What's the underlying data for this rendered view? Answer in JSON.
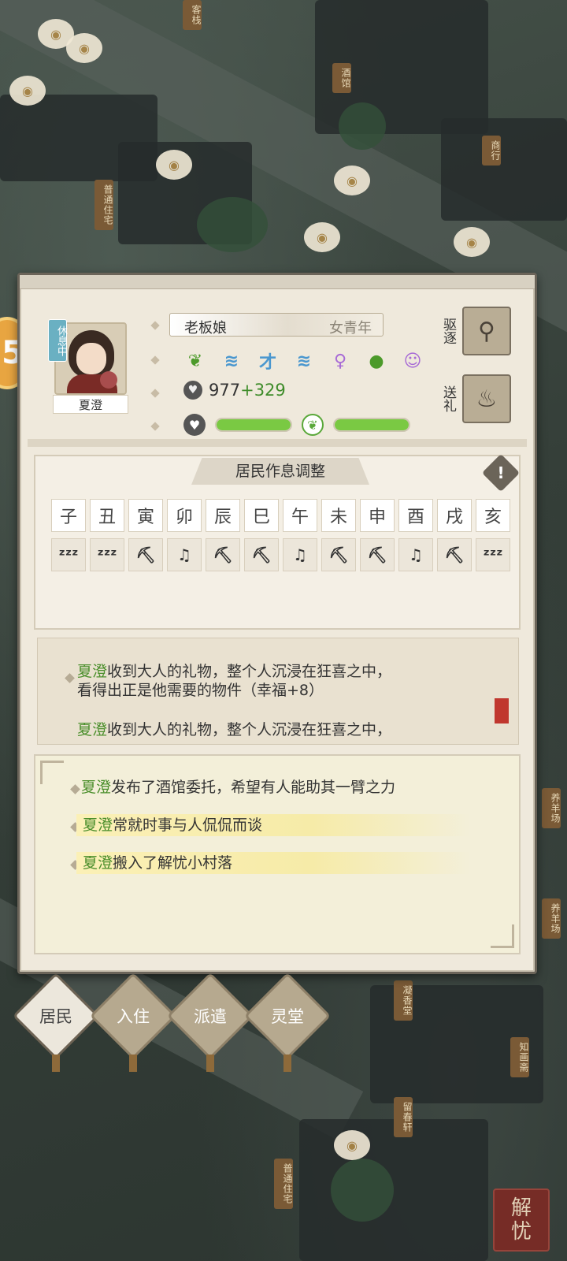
{
  "background": {
    "signs": [
      "客栈",
      "酒馆",
      "普通住宅",
      "商行",
      "养羊场",
      "养羊场",
      "凝香堂",
      "知画斋",
      "留春轩",
      "普通住宅"
    ]
  },
  "resident": {
    "status": "休息中",
    "name": "夏澄",
    "role": "老板娘",
    "age_group": "女青年",
    "traits": [
      {
        "icon": "heart-leaf-icon",
        "glyph": "❦",
        "color": "green"
      },
      {
        "icon": "fish-icon",
        "glyph": "≋",
        "color": "blue"
      },
      {
        "icon": "talent-icon",
        "glyph": "才",
        "color": "blue"
      },
      {
        "icon": "fish-icon",
        "glyph": "≋",
        "color": "blue"
      },
      {
        "icon": "person-purple-icon",
        "glyph": "♀",
        "color": "purple"
      },
      {
        "icon": "person-green-icon",
        "glyph": "●",
        "color": "green"
      },
      {
        "icon": "person-purple-icon",
        "glyph": "☺",
        "color": "purple"
      }
    ],
    "wealth": "977",
    "wealth_bonus": "+329",
    "health_level": 1.0,
    "happiness_level": 1.0
  },
  "actions": {
    "expel": "驱逐",
    "gift": "送礼"
  },
  "schedule": {
    "title": "居民作息调整",
    "hours": [
      "子",
      "丑",
      "寅",
      "卯",
      "辰",
      "巳",
      "午",
      "未",
      "申",
      "酉",
      "戌",
      "亥"
    ],
    "activities": [
      "sleep",
      "sleep",
      "work",
      "leisure",
      "work",
      "work",
      "leisure",
      "work",
      "work",
      "leisure",
      "work",
      "sleep"
    ],
    "activity_glyphs": {
      "sleep": "ᶻᶻᶻ",
      "work": "⛏",
      "leisure": "♫"
    }
  },
  "log1": {
    "name": "夏澄",
    "line1": "收到大人的礼物，整个人沉浸在狂喜之中，",
    "line2": "看得出正是他需要的物件（幸福+8）",
    "name_b": "夏澄",
    "line3": "收到大人的礼物，整个人沉浸在狂喜之中，"
  },
  "log2": [
    {
      "name": "夏澄",
      "text": "发布了酒馆委托，希望有人能助其一臂之力"
    },
    {
      "name": "夏澄",
      "text": "常就时事与人侃侃而谈"
    },
    {
      "name": "夏澄",
      "text": "搬入了解忧小村落"
    }
  ],
  "tabs": [
    "居民",
    "入住",
    "派遣",
    "灵堂"
  ],
  "corner_button": [
    "解",
    "忧"
  ]
}
